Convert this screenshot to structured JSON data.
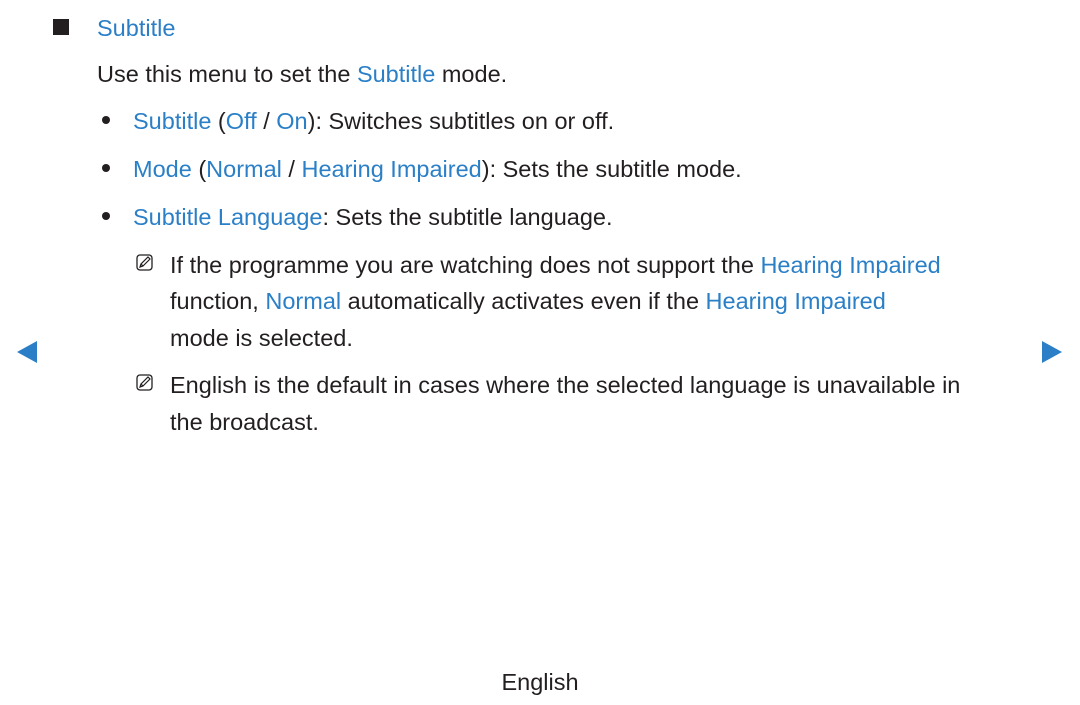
{
  "section": {
    "title": "Subtitle",
    "intro": [
      "Use this menu to set the ",
      "Subtitle",
      " mode."
    ]
  },
  "bullets": [
    {
      "parts": [
        "Subtitle",
        " (",
        "Off",
        " / ",
        "On",
        "): Switches subtitles on or off."
      ]
    },
    {
      "parts": [
        "Mode",
        " (",
        "Normal",
        " / ",
        "Hearing Impaired",
        "): Sets the subtitle mode."
      ]
    },
    {
      "parts": [
        "Subtitle Language",
        ": Sets the subtitle language."
      ]
    }
  ],
  "notes": [
    {
      "lines": [
        [
          "If the programme you are watching does not support the ",
          "Hearing Impaired"
        ],
        [
          "function, ",
          "Normal",
          " automatically activates even if the ",
          "Hearing Impaired"
        ],
        [
          "mode is selected."
        ]
      ]
    },
    {
      "lines": [
        [
          "English is the default in cases where the selected language is unavailable in"
        ],
        [
          "the broadcast."
        ]
      ]
    }
  ],
  "footer": {
    "language": "English"
  },
  "nav": {
    "prev_icon": "triangle-left-icon",
    "next_icon": "triangle-right-icon"
  },
  "colors": {
    "accent": "#2a7fc7",
    "text": "#231f20"
  }
}
